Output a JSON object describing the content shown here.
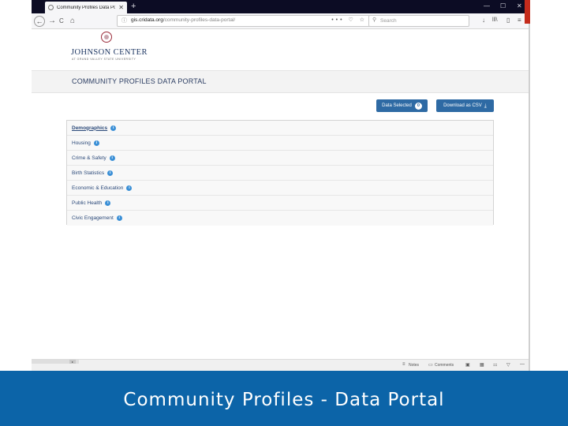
{
  "browser": {
    "tab_title": "Community Profiles Data Portal",
    "tab_close": "✕",
    "new_tab": "+",
    "window_controls": [
      "—",
      "☐",
      "✕"
    ],
    "nav": {
      "back": "←",
      "forward": "→",
      "reload": "C",
      "home": "⌂"
    },
    "url_domain": "gis.cridata.org",
    "url_path": "/community-profiles-data-portal/",
    "url_actions": "••• ♡ ☆",
    "search_placeholder": "Search",
    "toolbar_icons": {
      "download": "↓",
      "library": "lll\\",
      "sidebar": "▯",
      "menu": "≡"
    }
  },
  "site": {
    "logo_name": "JOHNSON CENTER",
    "logo_sub": "at Grand Valley State University",
    "portal_title": "COMMUNITY PROFILES DATA PORTAL",
    "data_selected_label": "Data Selected",
    "data_selected_count": "0",
    "download_label": "Download as CSV",
    "download_icon": "⤓",
    "categories": [
      {
        "label": "Demographics",
        "info": "i"
      },
      {
        "label": "Housing",
        "info": "i"
      },
      {
        "label": "Crime & Safety",
        "info": "i"
      },
      {
        "label": "Birth Statistics",
        "info": "i"
      },
      {
        "label": "Economic & Education",
        "info": "i"
      },
      {
        "label": "Public Health",
        "info": "i"
      },
      {
        "label": "Civic Engagement",
        "info": "i"
      }
    ]
  },
  "statusbar": {
    "notes": "Notes",
    "comments": "Comments",
    "scroll_btn": "▸"
  },
  "slide": {
    "footer_title": "Community Profiles - Data Portal",
    "footer_color": "#0c64a8"
  }
}
